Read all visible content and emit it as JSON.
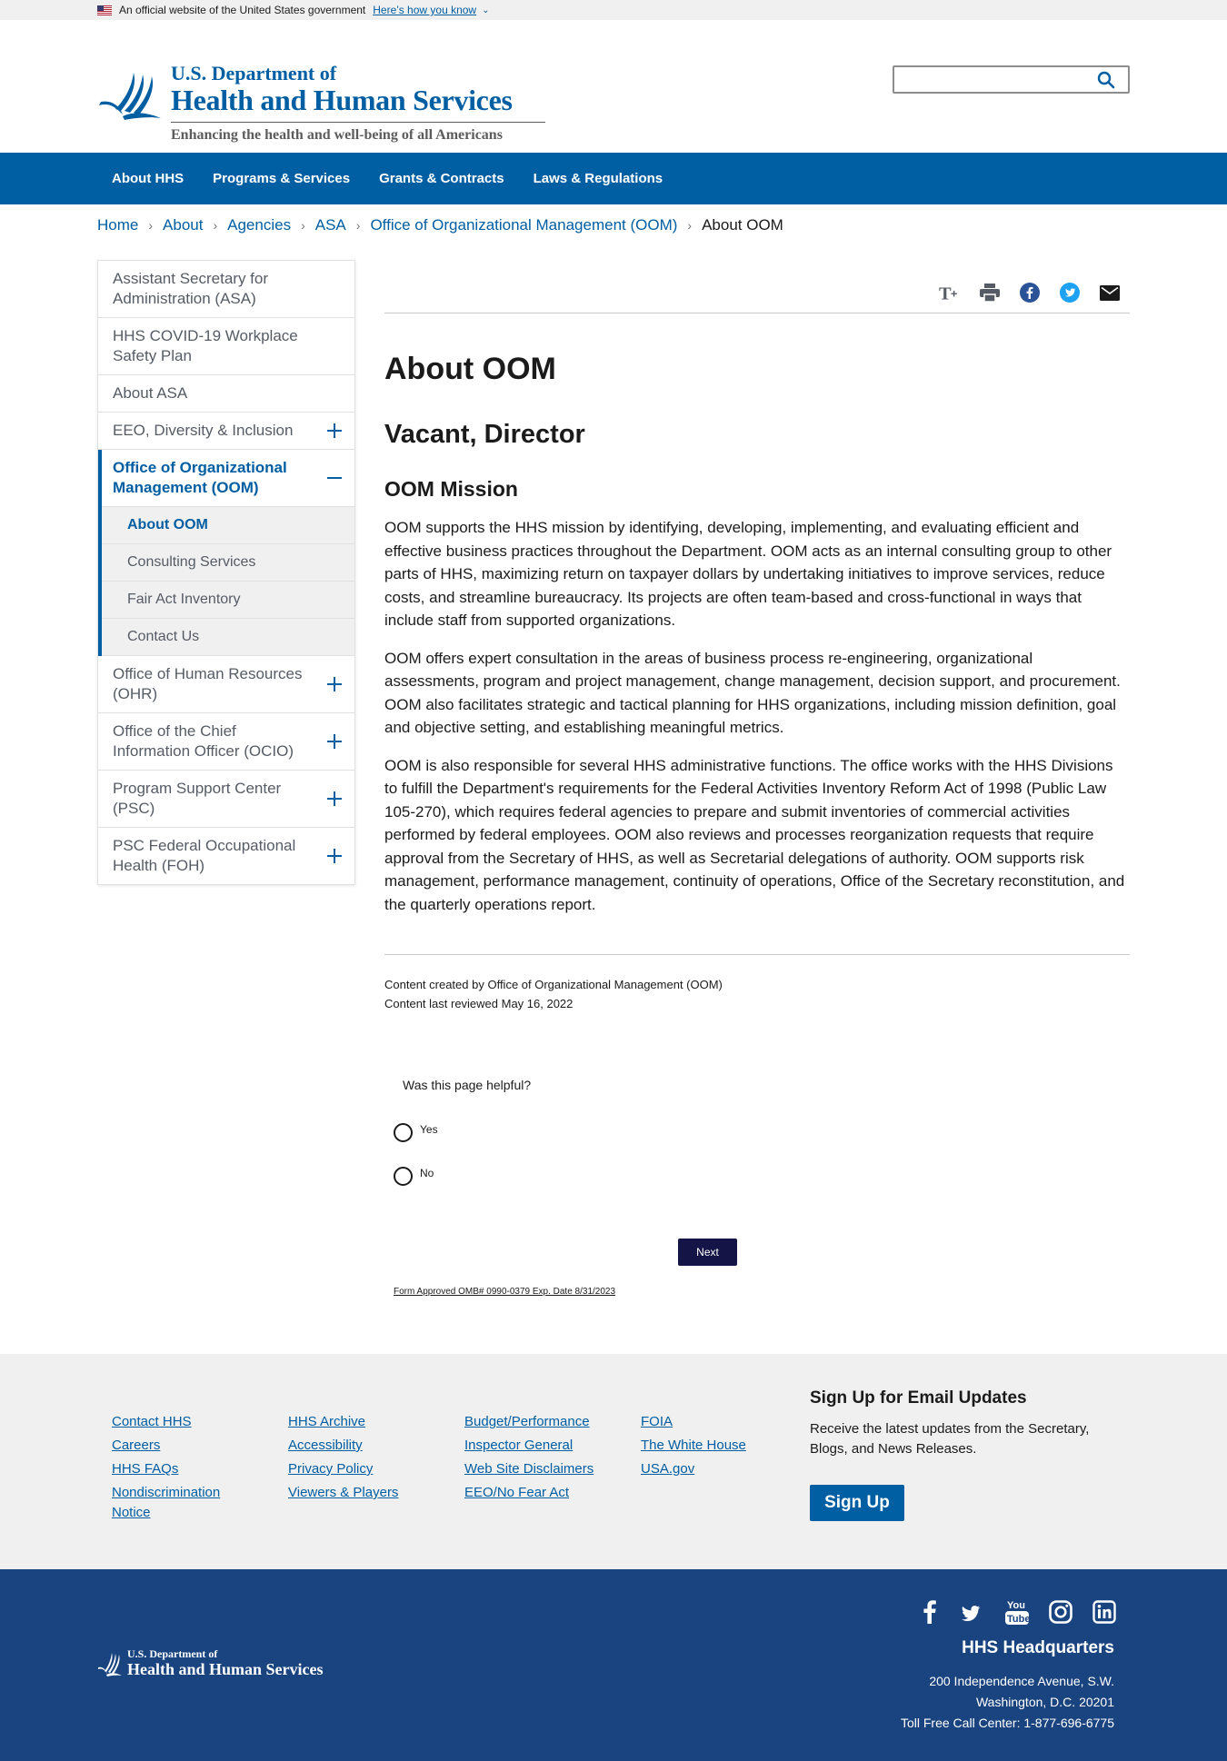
{
  "gov_banner": {
    "text": "An official website of the United States government",
    "how_link": "Here’s how you know"
  },
  "header": {
    "logo_line1": "U.S. Department of",
    "logo_line2": "Health and Human Services",
    "tagline": "Enhancing the health and well-being of all Americans",
    "search_placeholder": ""
  },
  "nav": {
    "items": [
      "About HHS",
      "Programs & Services",
      "Grants & Contracts",
      "Laws & Regulations"
    ]
  },
  "breadcrumb": {
    "items": [
      "Home",
      "About",
      "Agencies",
      "ASA",
      "Office of Organizational Management (OOM)"
    ],
    "current": "About OOM"
  },
  "sidebar": {
    "items": [
      {
        "label": "Assistant Secretary for Administration (ASA)"
      },
      {
        "label": "HHS COVID-19 Workplace Safety Plan"
      },
      {
        "label": "About ASA"
      },
      {
        "label": "EEO, Diversity & Inclusion"
      },
      {
        "label": "Office of Organizational Management (OOM)"
      },
      {
        "label": "Office of Human Resources (OHR)"
      },
      {
        "label": "Office of the Chief Information Officer (OCIO)"
      },
      {
        "label": "Program Support Center (PSC)"
      },
      {
        "label": "PSC Federal Occupational Health (FOH)"
      }
    ],
    "sub_items": [
      "About OOM",
      "Consulting Services",
      "Fair Act Inventory",
      "Contact Us"
    ]
  },
  "main": {
    "title": "About OOM",
    "director": "Vacant, Director",
    "mission_heading": "OOM Mission",
    "paragraphs": [
      "OOM supports the HHS mission by identifying, developing, implementing, and evaluating efficient and effective business practices throughout the Department. OOM acts as an internal consulting group to other parts of HHS, maximizing return on taxpayer dollars by undertaking initiatives to improve services, reduce costs, and streamline bureaucracy. Its projects are often team-based and cross-functional in ways that include staff from supported organizations.",
      "OOM offers expert consultation in the areas of business process re-engineering, organizational assessments, program and project management, change management, decision support, and procurement. OOM also facilitates strategic and tactical planning for HHS organizations, including mission definition, goal and objective setting, and establishing meaningful metrics.",
      "OOM is also responsible for several HHS administrative functions. The office works with the HHS Divisions to fulfill the Department's requirements for the Federal Activities Inventory Reform Act of 1998 (Public Law 105-270), which requires federal agencies to prepare and submit inventories of commercial activities performed by federal employees. OOM also reviews and processes reorganization requests that require approval from the Secretary of HHS, as well as Secretarial delegations of authority. OOM supports risk management, performance management, continuity of operations, Office of the Secretary reconstitution, and the quarterly operations report."
    ],
    "created_by": "Content created by Office of Organizational Management (OOM)",
    "last_reviewed": "Content last reviewed May 16, 2022"
  },
  "survey": {
    "question": "Was this page helpful?",
    "yes": "Yes",
    "no": "No",
    "next": "Next",
    "omb": "Form Approved OMB# 0990-0379 Exp. Date 8/31/2023"
  },
  "footer": {
    "col1": [
      "Contact HHS",
      "Careers",
      "HHS FAQs",
      "Nondiscrimination Notice"
    ],
    "col2": [
      "HHS Archive",
      "Accessibility",
      "Privacy Policy",
      "Viewers & Players"
    ],
    "col3": [
      "Budget/Performance",
      "Inspector General",
      "Web Site Disclaimers",
      "EEO/No Fear Act"
    ],
    "col4": [
      "FOIA",
      "The White House",
      "USA.gov"
    ],
    "signup_heading": "Sign Up for Email Updates",
    "signup_text": "Receive the latest updates from the Secretary, Blogs, and News Releases.",
    "signup_button": "Sign Up"
  },
  "footer_bottom": {
    "logo_line1": "U.S. Department of",
    "logo_line2": "Health and Human Services",
    "hq_heading": "HHS Headquarters",
    "address1": "200 Independence Avenue, S.W.",
    "address2": "Washington, D.C. 20201",
    "phone": "Toll Free Call Center: 1-877-696-6775",
    "socials": [
      "facebook-icon",
      "twitter-icon",
      "youtube-icon",
      "instagram-icon",
      "linkedin-icon"
    ]
  },
  "colors": {
    "primary": "#005ea2",
    "nav_bg": "#005ea2",
    "footer_dark": "#1a4480",
    "footer_light": "#f0f0f0",
    "next_button": "#141446"
  }
}
